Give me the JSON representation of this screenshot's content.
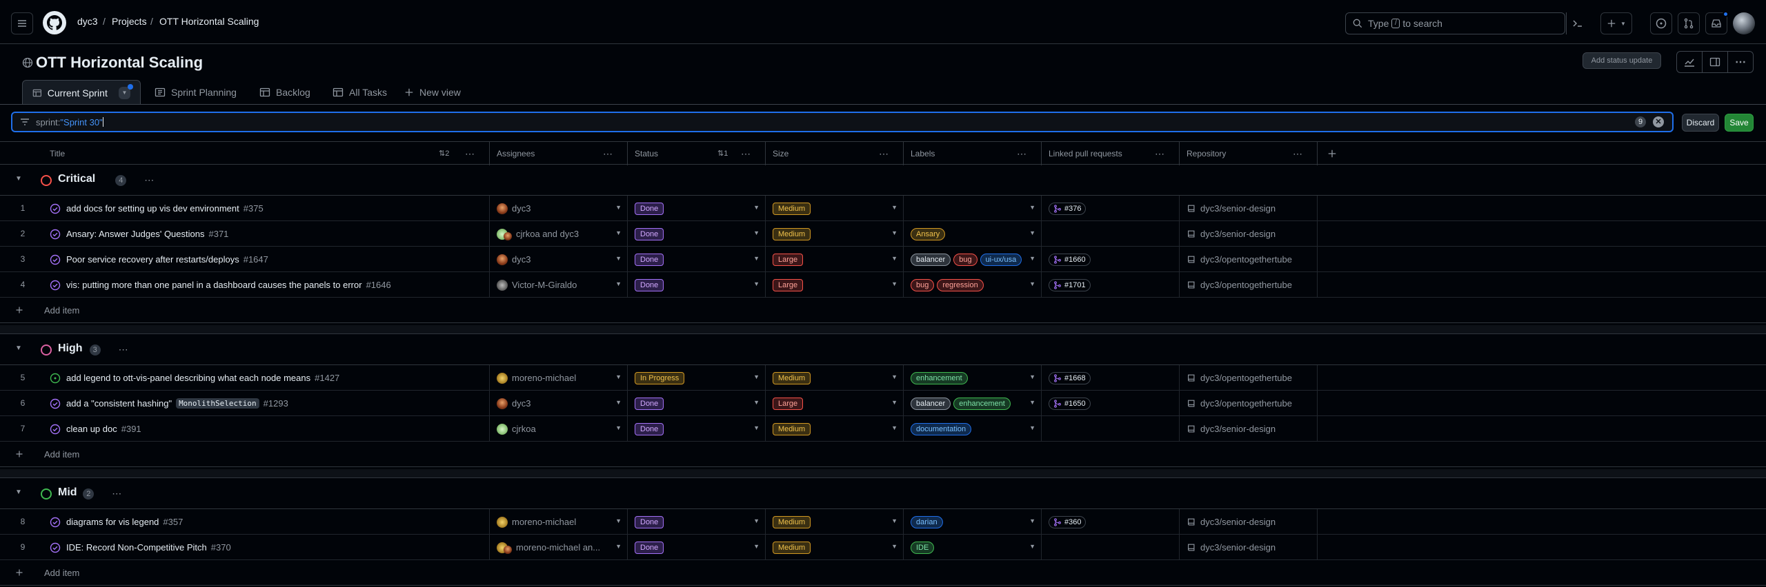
{
  "header": {
    "breadcrumbs": [
      "dyc3",
      "Projects",
      "OTT Horizontal Scaling"
    ],
    "search_prefix": "Type",
    "search_key": "/",
    "search_suffix": "to search"
  },
  "project": {
    "title": "OTT Horizontal Scaling",
    "status_update_label": "Add status update",
    "tabs": [
      {
        "label": "Current Sprint",
        "active": true
      },
      {
        "label": "Sprint Planning"
      },
      {
        "label": "Backlog"
      },
      {
        "label": "All Tasks"
      },
      {
        "label": "New view"
      }
    ]
  },
  "filter": {
    "prefix": "sprint:",
    "value": "\"Sprint 30\"",
    "count": "9",
    "discard_label": "Discard",
    "save_label": "Save"
  },
  "columns": {
    "title": "Title",
    "title_sort": "2",
    "assignees": "Assignees",
    "status": "Status",
    "status_sort": "1",
    "size": "Size",
    "labels": "Labels",
    "linked_prs": "Linked pull requests",
    "repository": "Repository"
  },
  "groups": [
    {
      "name": "Critical",
      "count": "4",
      "color": "#f85149"
    },
    {
      "name": "High",
      "count": "3",
      "color": "#db61a2"
    },
    {
      "name": "Mid",
      "count": "2",
      "color": "#3fb950"
    }
  ],
  "add_item_label": "Add item",
  "rows": [
    {
      "num": "1",
      "title": "add docs for setting up vis dev environment",
      "issue": "#375",
      "assignee": "dyc3",
      "status": "Done",
      "size": "Medium",
      "labels": [],
      "pr": "#376",
      "repo": "dyc3/senior-design"
    },
    {
      "num": "2",
      "title": "Ansary: Answer Judges' Questions",
      "issue": "#371",
      "assignee": "cjrkoa and dyc3",
      "status": "Done",
      "size": "Medium",
      "labels": [
        "Ansary"
      ],
      "pr": "",
      "repo": "dyc3/senior-design"
    },
    {
      "num": "3",
      "title": "Poor service recovery after restarts/deploys",
      "issue": "#1647",
      "assignee": "dyc3",
      "status": "Done",
      "size": "Large",
      "labels": [
        "balancer",
        "bug",
        "ui-ux/usa"
      ],
      "pr": "#1660",
      "repo": "dyc3/opentogethertube"
    },
    {
      "num": "4",
      "title": "vis: putting more than one panel in a dashboard causes the panels to error",
      "issue": "#1646",
      "assignee": "Victor-M-Giraldo",
      "status": "Done",
      "size": "Large",
      "labels": [
        "bug",
        "regression"
      ],
      "pr": "#1701",
      "repo": "dyc3/opentogethertube"
    },
    {
      "num": "5",
      "title": "add legend to ott-vis-panel describing what each node means",
      "issue": "#1427",
      "assignee": "moreno-michael",
      "status": "In Progress",
      "size": "Medium",
      "labels": [
        "enhancement"
      ],
      "pr": "#1668",
      "repo": "dyc3/opentogethertube"
    },
    {
      "num": "6",
      "title": "add a \"consistent hashing\"",
      "code": "MonolithSelection",
      "issue": "#1293",
      "assignee": "dyc3",
      "status": "Done",
      "size": "Large",
      "labels": [
        "balancer",
        "enhancement"
      ],
      "pr": "#1650",
      "repo": "dyc3/opentogethertube"
    },
    {
      "num": "7",
      "title": "clean up doc",
      "issue": "#391",
      "assignee": "cjrkoa",
      "status": "Done",
      "size": "Medium",
      "labels": [
        "documentation"
      ],
      "pr": "",
      "repo": "dyc3/senior-design"
    },
    {
      "num": "8",
      "title": "diagrams for vis legend",
      "issue": "#357",
      "assignee": "moreno-michael",
      "status": "Done",
      "size": "Medium",
      "labels": [
        "darian"
      ],
      "pr": "#360",
      "repo": "dyc3/senior-design"
    },
    {
      "num": "9",
      "title": "IDE: Record Non-Competitive Pitch",
      "issue": "#370",
      "assignee": "moreno-michael an...",
      "status": "Done",
      "size": "Medium",
      "labels": [
        "IDE"
      ],
      "pr": "",
      "repo": "dyc3/senior-design"
    }
  ],
  "colors": {
    "done": "#a371f7",
    "in_progress": "#d29922",
    "medium": "#d29922",
    "large": "#f85149",
    "accent_blue": "#1f6feb",
    "save_green": "#238636"
  }
}
